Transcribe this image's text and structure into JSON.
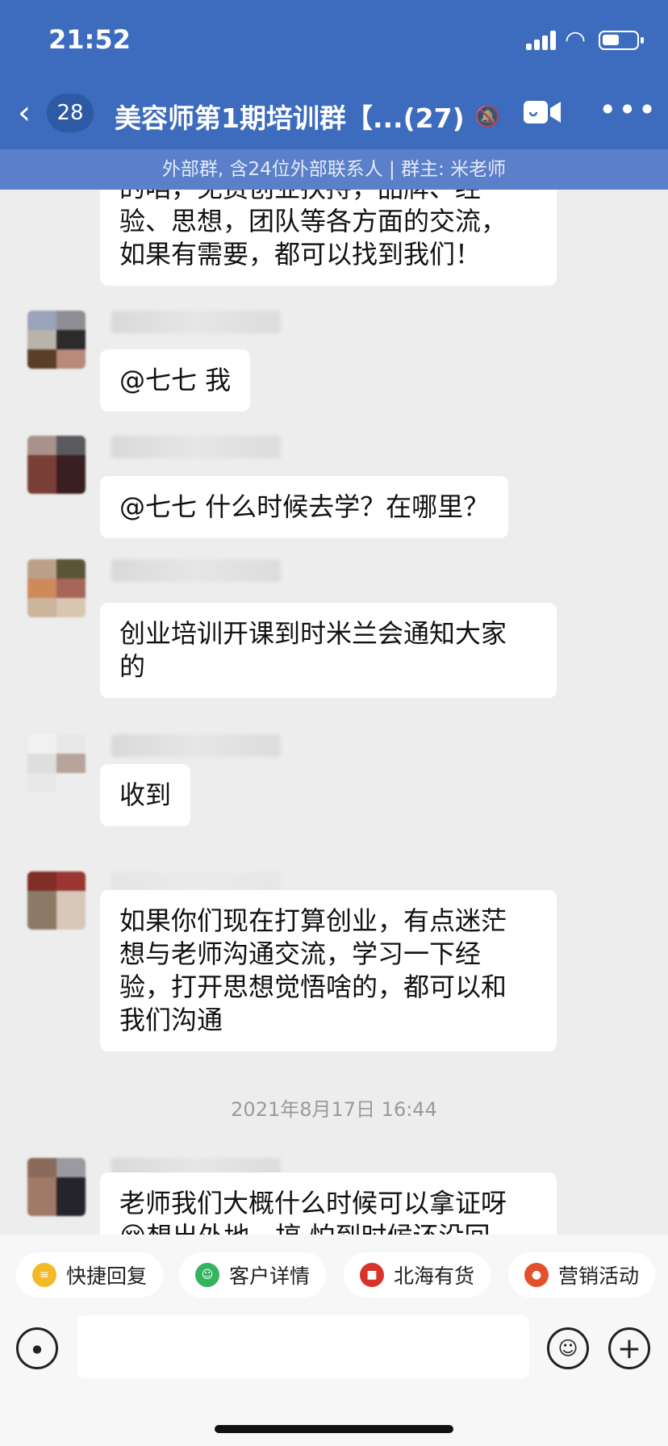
{
  "status": {
    "time": "21:52"
  },
  "header": {
    "unread_count": "28",
    "title": "美容师第1期培训群【...(27)",
    "subtitle": "外部群, 含24位外部联系人 | 群主: 米老师"
  },
  "messages": [
    {
      "text": "的咱，免费创业扶持，品牌、经\n验、思想，团队等各方面的交流，\n如果有需要，都可以找到我们！"
    },
    {
      "text": "@七七 我"
    },
    {
      "text": "@七七 什么时候去学？在哪里？"
    },
    {
      "text": "创业培训开课到时米兰会通知大家\n的"
    },
    {
      "text": "收到"
    },
    {
      "text": "如果你们现在打算创业，有点迷茫\n想与老师沟通交流，学习一下经\n验，打开思想觉悟啥的，都可以和\n我们沟通"
    },
    {
      "text": "老师我们大概什么时候可以拿证呀\n😔想出外地，搞 怕到时候还没回"
    }
  ],
  "timestamp": "2021年8月17日 16:44",
  "quick_actions": [
    {
      "label": "快捷回复",
      "icon": "quick-reply-icon",
      "color": "#f3b928"
    },
    {
      "label": "客户详情",
      "icon": "customer-icon",
      "color": "#35b35f"
    },
    {
      "label": "北海有货",
      "icon": "store-icon",
      "color": "#d9342b"
    },
    {
      "label": "营销活动",
      "icon": "marketing-icon",
      "color": "#e2512c"
    }
  ],
  "colors": {
    "header": "#3d6bbd",
    "subheader": "#5b7fc8"
  }
}
